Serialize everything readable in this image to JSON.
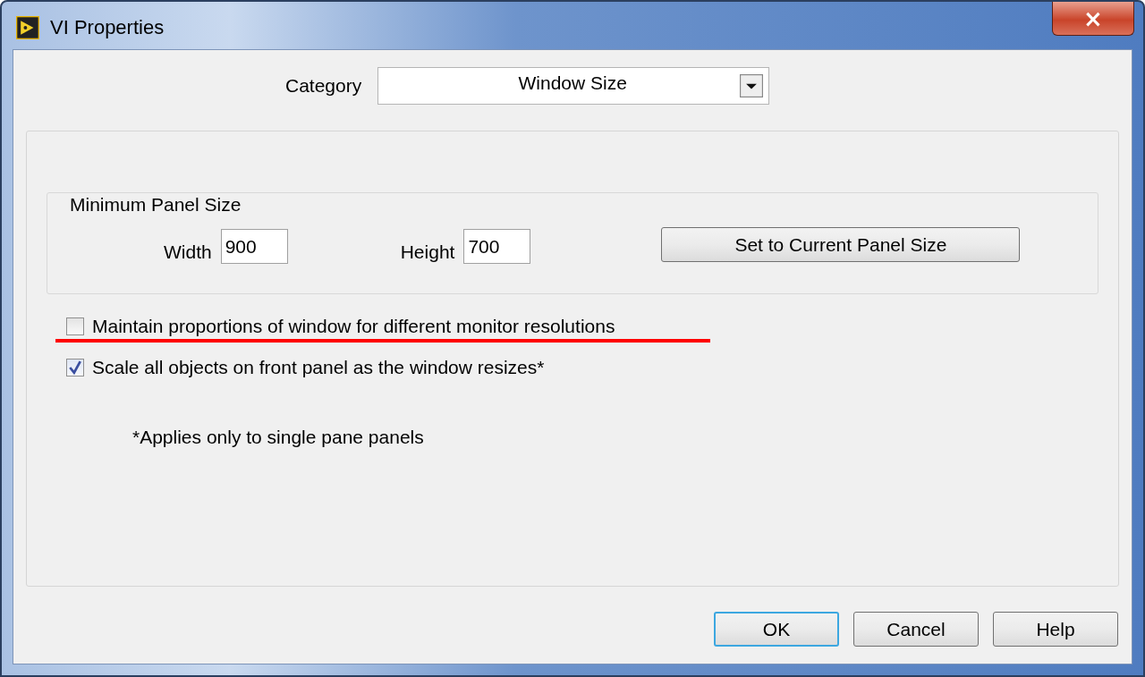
{
  "window": {
    "title": "VI Properties",
    "close_label": "×"
  },
  "category": {
    "label": "Category",
    "value": "Window Size"
  },
  "group": {
    "title": "Minimum Panel Size",
    "fields": [
      {
        "label": "Width",
        "value": "900"
      },
      {
        "label": "Height",
        "value": "700"
      }
    ],
    "button": "Set to Current Panel Size"
  },
  "options": [
    {
      "label": "Maintain proportions of window for different monitor resolutions",
      "checked": false,
      "highlighted": true
    },
    {
      "label": "Scale all objects on front panel as the window resizes*",
      "checked": true,
      "highlighted": false
    }
  ],
  "footnote": "*Applies only to single pane panels",
  "buttons": [
    {
      "label": "OK",
      "default": true
    },
    {
      "label": "Cancel",
      "default": false
    },
    {
      "label": "Help",
      "default": false
    }
  ]
}
